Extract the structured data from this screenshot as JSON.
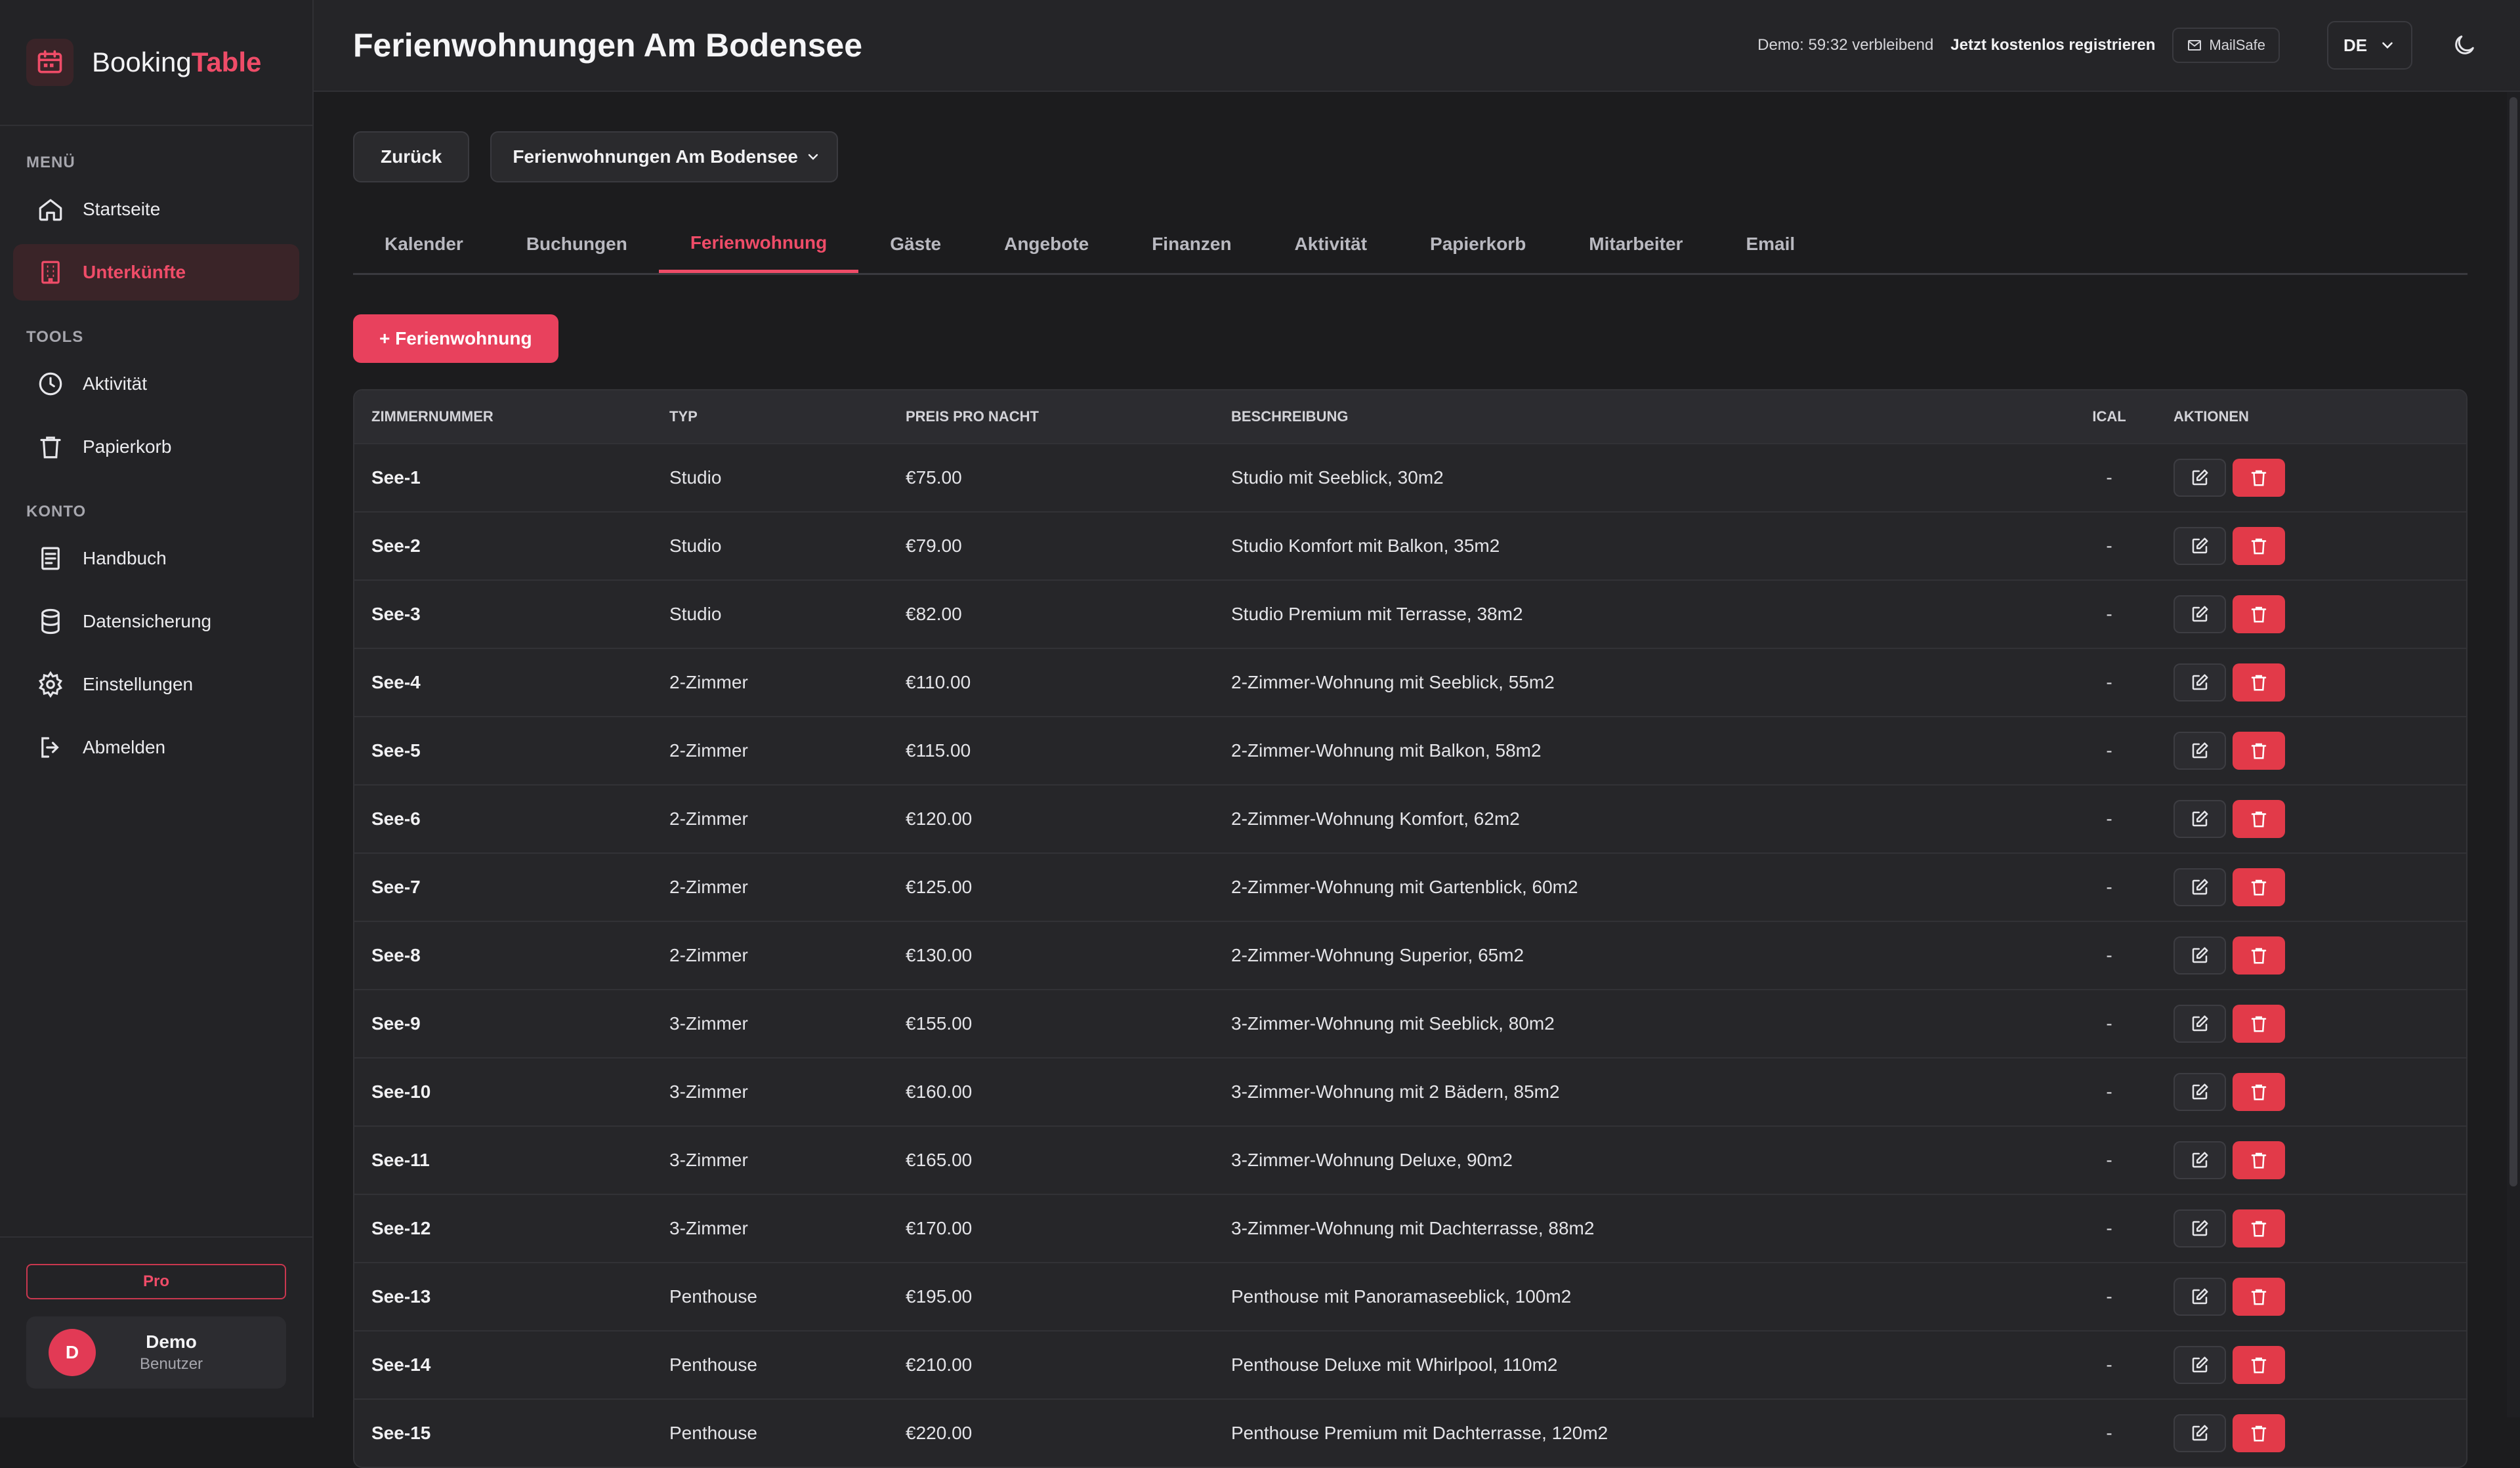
{
  "brand": {
    "name_part1": "Booking",
    "name_part2": "Table"
  },
  "sidebar": {
    "section_menu": "MENÜ",
    "section_tools": "TOOLS",
    "section_account": "KONTO",
    "items": [
      {
        "label": "Startseite",
        "icon": "home-icon"
      },
      {
        "label": "Unterkünfte",
        "icon": "building-icon",
        "active": true
      },
      {
        "label": "Aktivität",
        "icon": "clock-icon"
      },
      {
        "label": "Papierkorb",
        "icon": "trash-icon"
      },
      {
        "label": "Handbuch",
        "icon": "document-icon"
      },
      {
        "label": "Datensicherung",
        "icon": "database-icon"
      },
      {
        "label": "Einstellungen",
        "icon": "gear-icon"
      },
      {
        "label": "Abmelden",
        "icon": "logout-icon"
      }
    ],
    "plan_badge": "Pro",
    "user": {
      "initial": "D",
      "name": "Demo",
      "role": "Benutzer"
    }
  },
  "header": {
    "title": "Ferienwohnungen Am Bodensee",
    "demo_timer": "Demo: 59:32 verbleibend",
    "register": "Jetzt kostenlos registrieren",
    "mailsafe": "MailSafe",
    "language": "DE"
  },
  "controls": {
    "back": "Zurück",
    "property_select": "Ferienwohnungen Am Bodensee"
  },
  "tabs": [
    "Kalender",
    "Buchungen",
    "Ferienwohnung",
    "Gäste",
    "Angebote",
    "Finanzen",
    "Aktivität",
    "Papierkorb",
    "Mitarbeiter",
    "Email"
  ],
  "active_tab": "Ferienwohnung",
  "add_button": "+ Ferienwohnung",
  "table": {
    "headers": [
      "ZIMMERNUMMER",
      "TYP",
      "PREIS PRO NACHT",
      "BESCHREIBUNG",
      "ICAL",
      "AKTIONEN"
    ],
    "rows": [
      [
        "See-1",
        "Studio",
        "€75.00",
        "Studio mit Seeblick, 30m2",
        "-"
      ],
      [
        "See-2",
        "Studio",
        "€79.00",
        "Studio Komfort mit Balkon, 35m2",
        "-"
      ],
      [
        "See-3",
        "Studio",
        "€82.00",
        "Studio Premium mit Terrasse, 38m2",
        "-"
      ],
      [
        "See-4",
        "2-Zimmer",
        "€110.00",
        "2-Zimmer-Wohnung mit Seeblick, 55m2",
        "-"
      ],
      [
        "See-5",
        "2-Zimmer",
        "€115.00",
        "2-Zimmer-Wohnung mit Balkon, 58m2",
        "-"
      ],
      [
        "See-6",
        "2-Zimmer",
        "€120.00",
        "2-Zimmer-Wohnung Komfort, 62m2",
        "-"
      ],
      [
        "See-7",
        "2-Zimmer",
        "€125.00",
        "2-Zimmer-Wohnung mit Gartenblick, 60m2",
        "-"
      ],
      [
        "See-8",
        "2-Zimmer",
        "€130.00",
        "2-Zimmer-Wohnung Superior, 65m2",
        "-"
      ],
      [
        "See-9",
        "3-Zimmer",
        "€155.00",
        "3-Zimmer-Wohnung mit Seeblick, 80m2",
        "-"
      ],
      [
        "See-10",
        "3-Zimmer",
        "€160.00",
        "3-Zimmer-Wohnung mit 2 Bädern, 85m2",
        "-"
      ],
      [
        "See-11",
        "3-Zimmer",
        "€165.00",
        "3-Zimmer-Wohnung Deluxe, 90m2",
        "-"
      ],
      [
        "See-12",
        "3-Zimmer",
        "€170.00",
        "3-Zimmer-Wohnung mit Dachterrasse, 88m2",
        "-"
      ],
      [
        "See-13",
        "Penthouse",
        "€195.00",
        "Penthouse mit Panoramaseeblick, 100m2",
        "-"
      ],
      [
        "See-14",
        "Penthouse",
        "€210.00",
        "Penthouse Deluxe mit Whirlpool, 110m2",
        "-"
      ],
      [
        "See-15",
        "Penthouse",
        "€220.00",
        "Penthouse Premium mit Dachterrasse, 120m2",
        "-"
      ]
    ]
  },
  "colors": {
    "accent": "#ef4c68",
    "delete": "#e23a49",
    "background": "#1c1c1e",
    "sidebar": "#232326"
  }
}
